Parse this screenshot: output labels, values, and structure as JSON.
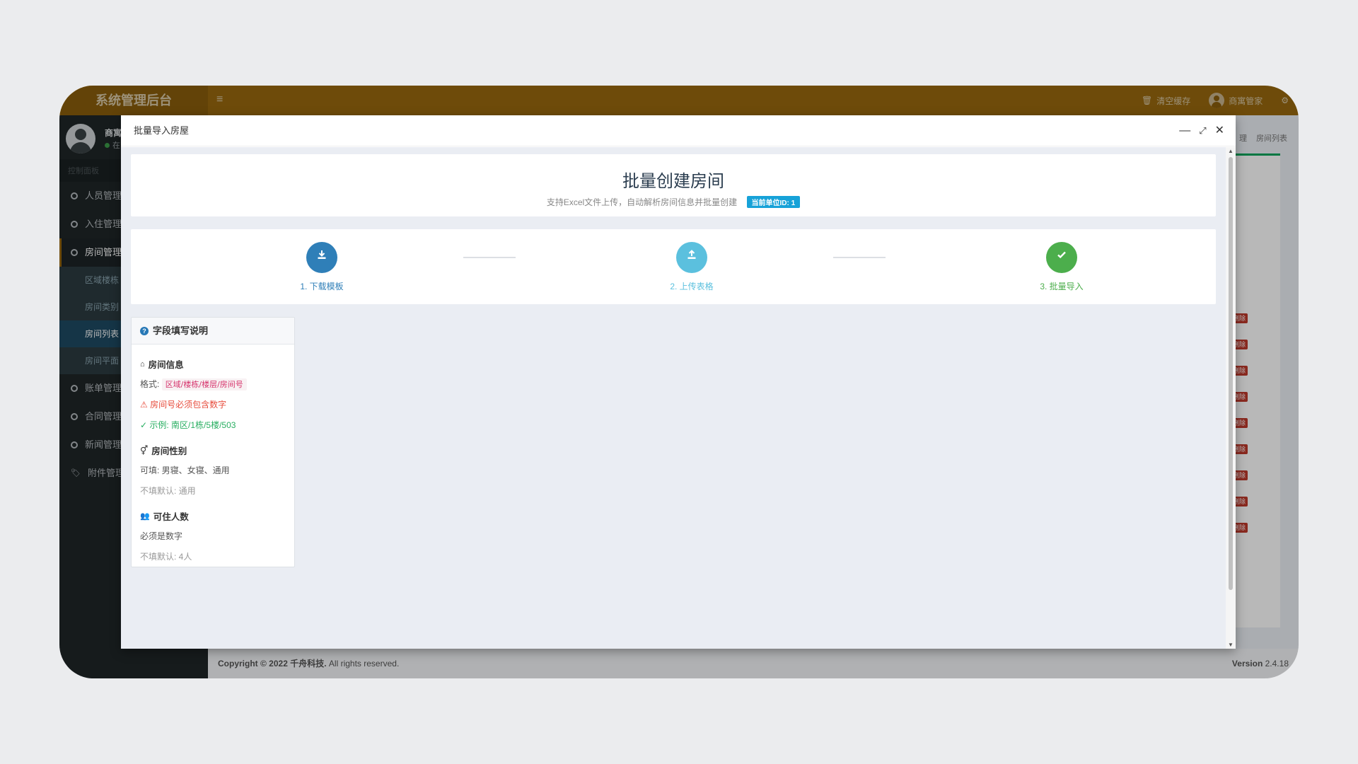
{
  "app": {
    "brand": "系统管理后台",
    "toggle_icon": "≡"
  },
  "navbar": {
    "clear_cache": "清空缓存",
    "user": "商寓管家"
  },
  "sidebar": {
    "user_name": "商寓",
    "user_status": "在",
    "menu_header": "控制面板",
    "items": [
      {
        "label": "人员管理"
      },
      {
        "label": "入住管理"
      },
      {
        "label": "房间管理"
      },
      {
        "label": "账单管理"
      },
      {
        "label": "合同管理"
      },
      {
        "label": "新闻管理"
      },
      {
        "label": "附件管理"
      }
    ],
    "subitems": [
      {
        "label": "区域楼栋"
      },
      {
        "label": "房间类别"
      },
      {
        "label": "房间列表"
      },
      {
        "label": "房间平面"
      }
    ]
  },
  "background": {
    "breadcrumb_tail": "理",
    "tab": "房间列表",
    "delete_label": "删除"
  },
  "footer": {
    "copyright_prefix": "Copyright © 2022",
    "company": "千舟科技.",
    "rights": "All rights reserved.",
    "version_label": "Version",
    "version": "2.4.18"
  },
  "modal": {
    "title": "批量导入房屋",
    "hero": {
      "title": "批量创建房间",
      "subtitle": "支持Excel文件上传，自动解析房间信息并批量创建",
      "badge": "当前单位ID: 1"
    },
    "steps": [
      {
        "label": "1. 下载模板",
        "icon": "download-icon",
        "color": "#2f7fb8"
      },
      {
        "label": "2. 上传表格",
        "icon": "upload-icon",
        "color": "#5bc0de"
      },
      {
        "label": "3. 批量导入",
        "icon": "check-icon",
        "color": "#4cae4c"
      }
    ],
    "fields": {
      "title": "字段填写说明",
      "room_info": {
        "heading": "房间信息",
        "format_label": "格式:",
        "format_value": "区域/楼栋/楼层/房间号",
        "warning": "房间号必须包含数字",
        "example": "✓ 示例: 南区/1栋/5楼/503"
      },
      "room_gender": {
        "heading": "房间性别",
        "options": "可填: 男寝、女寝、通用",
        "default": "不填默认: 通用"
      },
      "capacity": {
        "heading": "可住人数",
        "rule": "必须是数字",
        "default": "不填默认: 4人"
      }
    }
  }
}
